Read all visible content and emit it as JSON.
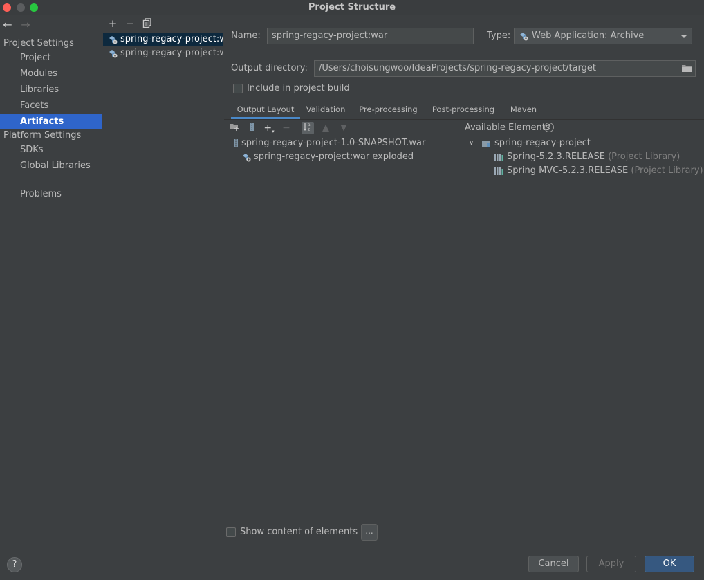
{
  "window": {
    "title": "Project Structure"
  },
  "sidebar": {
    "project_settings_header": "Project Settings",
    "platform_settings_header": "Platform Settings",
    "items": [
      {
        "label": "Project"
      },
      {
        "label": "Modules"
      },
      {
        "label": "Libraries"
      },
      {
        "label": "Facets"
      },
      {
        "label": "Artifacts",
        "selected": true
      },
      {
        "label": "SDKs"
      },
      {
        "label": "Global Libraries"
      },
      {
        "label": "Problems"
      }
    ]
  },
  "artifacts": {
    "items": [
      {
        "label": "spring-regacy-project:war",
        "selected": true
      },
      {
        "label": "spring-regacy-project:war exploded"
      }
    ]
  },
  "form": {
    "name_label": "Name:",
    "name_value": "spring-regacy-project:war",
    "type_label": "Type:",
    "type_value": "Web Application: Archive",
    "output_dir_label": "Output directory:",
    "output_dir_value": "/Users/choisungwoo/IdeaProjects/spring-regacy-project/target",
    "include_in_build_label": "Include in project build"
  },
  "tabs": [
    {
      "label": "Output Layout",
      "active": true
    },
    {
      "label": "Validation"
    },
    {
      "label": "Pre-processing"
    },
    {
      "label": "Post-processing"
    },
    {
      "label": "Maven"
    }
  ],
  "layout_tree": {
    "root": "spring-regacy-project-1.0-SNAPSHOT.war",
    "child": "spring-regacy-project:war exploded"
  },
  "available": {
    "title": "Available Elements",
    "help": "?",
    "root": "spring-regacy-project",
    "libraries": [
      {
        "name": "Spring-5.2.3.RELEASE",
        "suffix": "(Project Library)"
      },
      {
        "name": "Spring MVC-5.2.3.RELEASE",
        "suffix": "(Project Library)"
      }
    ]
  },
  "bottom": {
    "show_content_label": "Show content of elements",
    "ellipsis": "..."
  },
  "footer": {
    "help": "?",
    "cancel": "Cancel",
    "apply": "Apply",
    "ok": "OK"
  },
  "colors": {
    "selection": "#2f65ca",
    "list_selection": "#0d293e",
    "ok_button": "#365880",
    "background": "#3c3f41"
  }
}
